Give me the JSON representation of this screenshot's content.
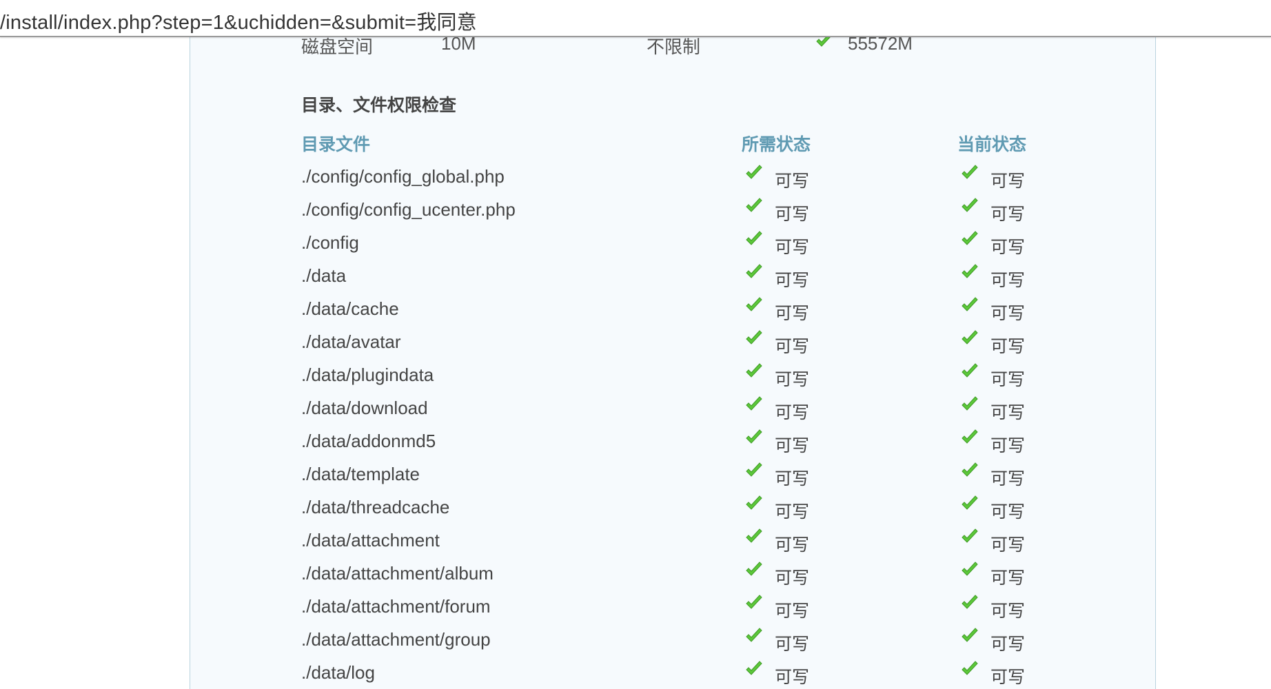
{
  "address_bar": {
    "url": "/install/index.php?step=1&uchidden=&submit=我同意"
  },
  "env_row": {
    "name": "磁盘空间",
    "required": "10M",
    "best": "不限制",
    "current": "55572M"
  },
  "section": {
    "title": "目录、文件权限检查",
    "headers": {
      "file": "目录文件",
      "required": "所需状态",
      "current": "当前状态"
    }
  },
  "colors": {
    "check_green": "#5cc83a",
    "header_blue": "#5f9ab2",
    "panel_bg": "#f6fafd",
    "panel_border": "#b9d3de"
  },
  "rows": [
    {
      "path": "./config/config_global.php",
      "required": "可写",
      "current": "可写"
    },
    {
      "path": "./config/config_ucenter.php",
      "required": "可写",
      "current": "可写"
    },
    {
      "path": "./config",
      "required": "可写",
      "current": "可写"
    },
    {
      "path": "./data",
      "required": "可写",
      "current": "可写"
    },
    {
      "path": "./data/cache",
      "required": "可写",
      "current": "可写"
    },
    {
      "path": "./data/avatar",
      "required": "可写",
      "current": "可写"
    },
    {
      "path": "./data/plugindata",
      "required": "可写",
      "current": "可写"
    },
    {
      "path": "./data/download",
      "required": "可写",
      "current": "可写"
    },
    {
      "path": "./data/addonmd5",
      "required": "可写",
      "current": "可写"
    },
    {
      "path": "./data/template",
      "required": "可写",
      "current": "可写"
    },
    {
      "path": "./data/threadcache",
      "required": "可写",
      "current": "可写"
    },
    {
      "path": "./data/attachment",
      "required": "可写",
      "current": "可写"
    },
    {
      "path": "./data/attachment/album",
      "required": "可写",
      "current": "可写"
    },
    {
      "path": "./data/attachment/forum",
      "required": "可写",
      "current": "可写"
    },
    {
      "path": "./data/attachment/group",
      "required": "可写",
      "current": "可写"
    },
    {
      "path": "./data/log",
      "required": "可写",
      "current": "可写"
    }
  ],
  "icons": {
    "status_ok": "check-icon"
  }
}
